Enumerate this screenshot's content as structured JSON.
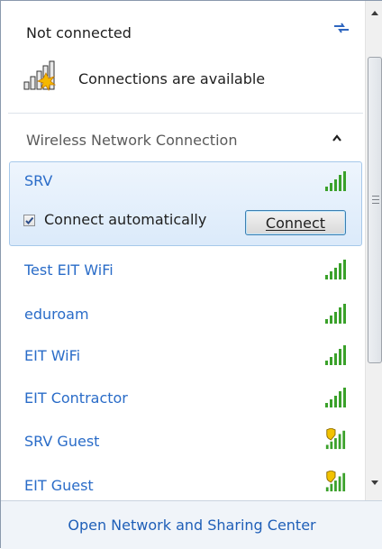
{
  "status": {
    "title": "Not connected",
    "availability": "Connections are available"
  },
  "section": {
    "title": "Wireless Network Connection"
  },
  "selected_network": {
    "name": "SRV",
    "connect_automatically_label": "Connect automatically",
    "connect_automatically_checked": true,
    "connect_button_label": "Connect"
  },
  "networks": [
    {
      "name": "Test EIT WiFi",
      "secured_warning": false,
      "signal": "full"
    },
    {
      "name": "eduroam",
      "secured_warning": false,
      "signal": "full"
    },
    {
      "name": "EIT WiFi",
      "secured_warning": false,
      "signal": "full"
    },
    {
      "name": "EIT Contractor",
      "secured_warning": false,
      "signal": "full"
    },
    {
      "name": "SRV Guest",
      "secured_warning": true,
      "signal": "full"
    },
    {
      "name": "EIT Guest",
      "secured_warning": true,
      "signal": "full"
    }
  ],
  "footer": {
    "link": "Open Network and Sharing Center"
  },
  "icons": {
    "refresh": "refresh-icon",
    "connections": "signal-warning-icon",
    "collapse": "chevron-up-icon",
    "signal": "signal-bars-icon",
    "shield": "shield-icon"
  },
  "colors": {
    "link": "#2a6cc8",
    "signal": "#3aa12a",
    "selection": "#dbeafa"
  }
}
